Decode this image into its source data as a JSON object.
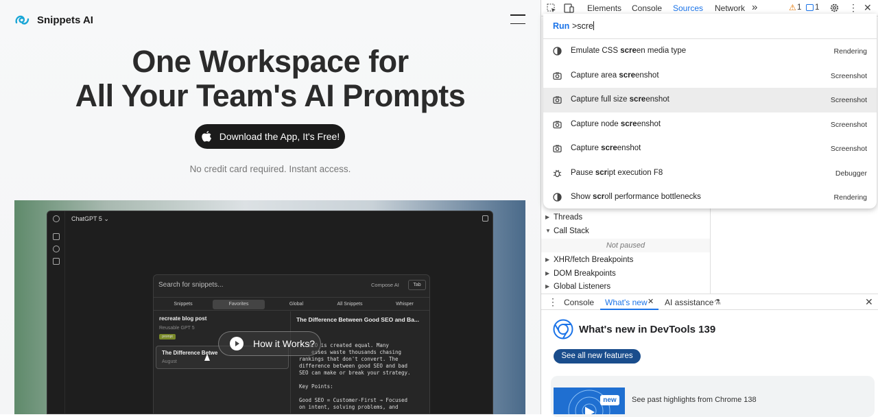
{
  "page": {
    "logo_text": "Snippets AI",
    "hero_line1": "One Workspace for",
    "hero_line2": "All Your Team's AI Prompts",
    "cta_label": "Download the App, It's Free!",
    "subtext": "No credit card required. Instant access.",
    "play_label": "How it Works?",
    "mock": {
      "app_title": "ChatGPT 5 ⌄",
      "search_placeholder": "Search for snippets...",
      "compose": "Compose AI",
      "tab_key": "Tab",
      "tabs": [
        "Snippets",
        "Favorites",
        "Global",
        "All Snippets",
        "Whisper"
      ],
      "item1_title": "recreate blog post",
      "item1_sub": "Reusable GPT 5",
      "item1_tag": "prompt",
      "item2_title": "The Difference Betwe",
      "item2_sub": "August",
      "right_title": "The Difference Between Good SEO and Ba...",
      "right_body": "   SEO is created equal. Many\n    esses waste thousands chasing\nrankings that don't convert. The\ndifference between good SEO and bad\nSEO can make or break your strategy.\n\nKey Points:\n\nGood SEO = Customer-First → Focused\non intent, solving problems, and"
    }
  },
  "devtools": {
    "tabs": [
      "Elements",
      "Console",
      "Sources",
      "Network"
    ],
    "more": "»",
    "warnings": "1",
    "messages": "1",
    "command": {
      "run": "Run",
      "query": ">scre",
      "items": [
        {
          "pre": "Emulate CSS ",
          "bold": "scre",
          "post": "en media type",
          "category": "Rendering",
          "icon": "rendering-icon"
        },
        {
          "pre": "Capture area ",
          "bold": "scre",
          "post": "enshot",
          "category": "Screenshot",
          "icon": "camera-icon"
        },
        {
          "pre": "Capture full size ",
          "bold": "scre",
          "post": "enshot",
          "category": "Screenshot",
          "icon": "camera-icon"
        },
        {
          "pre": "Capture node ",
          "bold": "scre",
          "post": "enshot",
          "category": "Screenshot",
          "icon": "camera-icon"
        },
        {
          "pre": "Capture ",
          "bold": "scre",
          "post": "enshot",
          "category": "Screenshot",
          "icon": "camera-icon"
        },
        {
          "pre": "Pause ",
          "bold": "scr",
          "post": "ipt execution F8",
          "category": "Debugger",
          "icon": "bug-icon"
        },
        {
          "pre": "Show ",
          "bold": "scr",
          "post": "oll performance bottlenecks",
          "category": "Rendering",
          "icon": "rendering-icon"
        }
      ]
    },
    "sidebar": {
      "threads": "Threads",
      "call_stack": "Call Stack",
      "not_paused": "Not paused",
      "xhr": "XHR/fetch Breakpoints",
      "dom": "DOM Breakpoints",
      "global": "Global Listeners"
    },
    "drawer": {
      "console": "Console",
      "whats_new": "What's new",
      "ai": "AI assistance",
      "title": "What's new in DevTools 139",
      "see_all": "See all new features",
      "badge": "new",
      "highlights": "See past highlights from Chrome 138"
    }
  }
}
